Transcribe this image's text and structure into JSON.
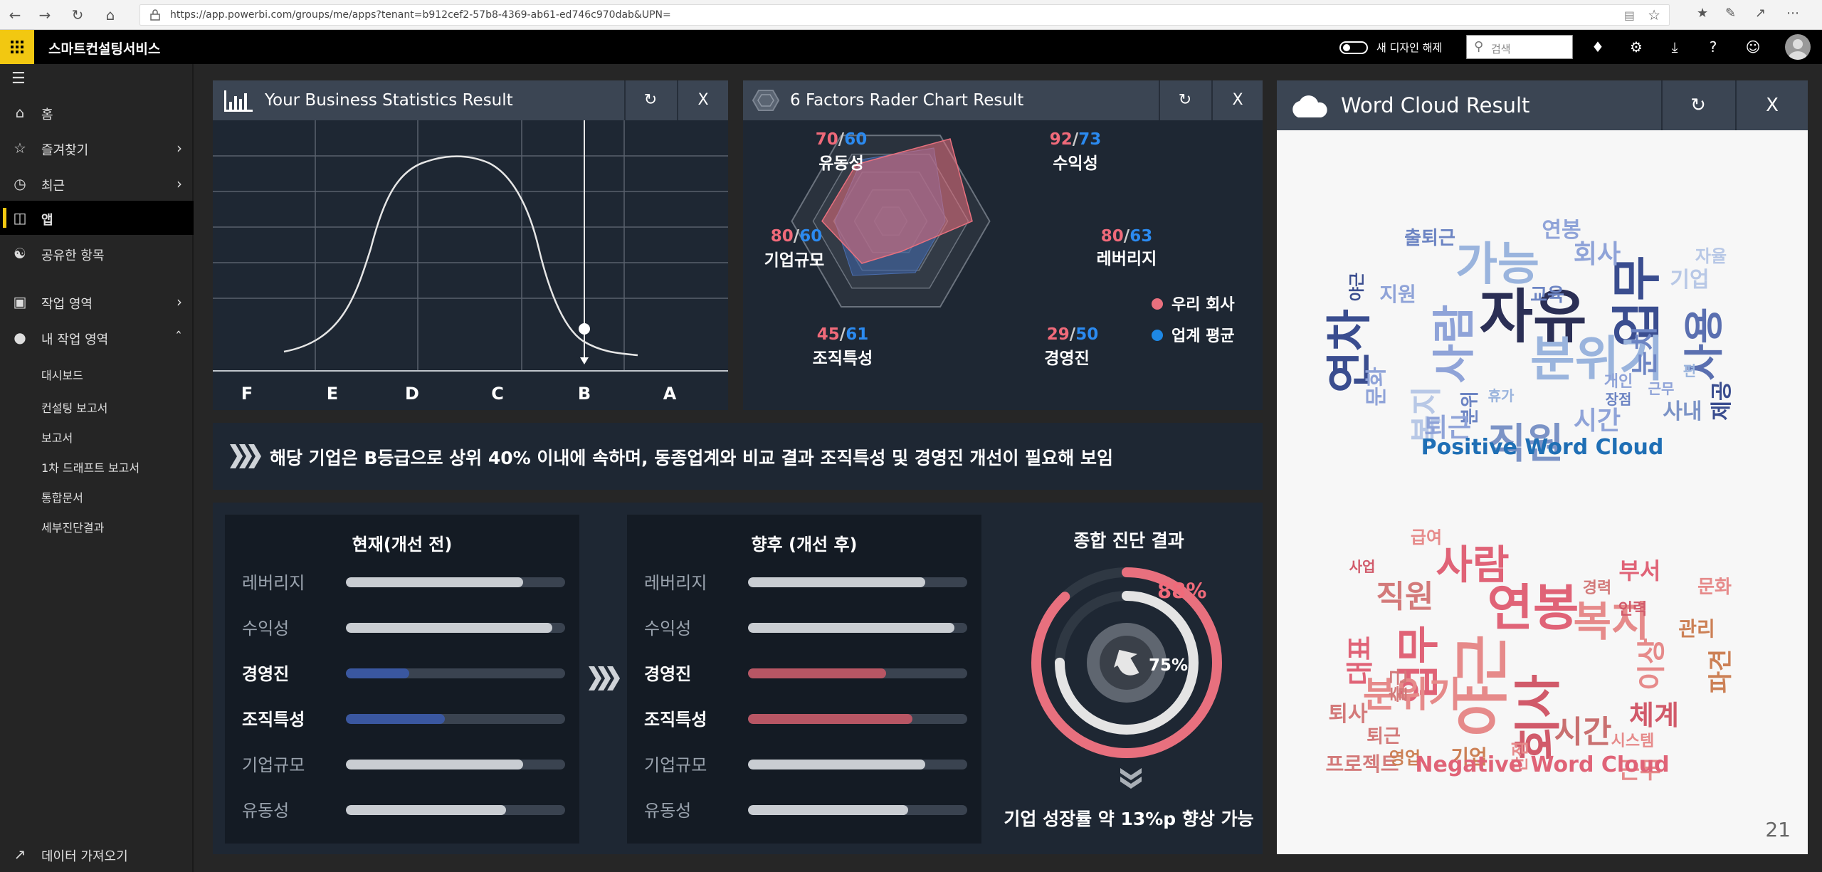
{
  "browser": {
    "url": "https://app.powerbi.com/groups/me/apps?tenant=b912cef2-57b8-4369-ab61-ed746c970dab&UPN="
  },
  "header": {
    "app_title": "스마트컨설팅서비스",
    "new_design_label": "새 디자인 해제",
    "search_placeholder": "검색"
  },
  "leftnav": {
    "items": [
      {
        "label": "홈",
        "icon": "home-icon"
      },
      {
        "label": "즐겨찾기",
        "icon": "star-icon"
      },
      {
        "label": "최근",
        "icon": "clock-icon"
      },
      {
        "label": "앱",
        "icon": "apps-icon"
      },
      {
        "label": "공유한 항목",
        "icon": "shared-icon"
      },
      {
        "label": "작업 영역",
        "icon": "workspace-icon"
      },
      {
        "label": "내 작업 영역",
        "icon": "user-icon"
      }
    ],
    "sub_items": [
      "대시보드",
      "컨설팅 보고서",
      "보고서",
      "1차 드래프트 보고서",
      "통합문서",
      "세부진단결과"
    ],
    "footer": "데이터 가져오기"
  },
  "stats_panel": {
    "title": "Your Business Statistics Result",
    "grades": [
      "F",
      "E",
      "D",
      "C",
      "B",
      "A"
    ],
    "current_grade": "B",
    "close_label": "X"
  },
  "radar_panel": {
    "title": "6 Factors Rader Chart Result",
    "close_label": "X",
    "legend": [
      {
        "label": "우리 회사",
        "color": "#e8707e"
      },
      {
        "label": "업계 평균",
        "color": "#1e88e5"
      }
    ],
    "factors": [
      {
        "name": "유동성",
        "ours": "70",
        "avg": "60"
      },
      {
        "name": "수익성",
        "ours": "92",
        "avg": "73"
      },
      {
        "name": "레버리지",
        "ours": "80",
        "avg": "63"
      },
      {
        "name": "경영진",
        "ours": "29",
        "avg": "50"
      },
      {
        "name": "조직특성",
        "ours": "45",
        "avg": "61"
      },
      {
        "name": "기업규모",
        "ours": "80",
        "avg": "60"
      }
    ],
    "sep": "/"
  },
  "banner": {
    "text": "해당 기업은 B등급으로 상위 40% 이내에 속하며, 동종업계와 비교 결과 조직특성 및 경영진 개선이 필요해 보임"
  },
  "before": {
    "title": "현재(개선 전)",
    "rows": [
      {
        "label": "레버리지",
        "value": 0.81,
        "highlight": false
      },
      {
        "label": "수익성",
        "value": 0.94,
        "highlight": false
      },
      {
        "label": "경영진",
        "value": 0.29,
        "highlight": true
      },
      {
        "label": "조직특성",
        "value": 0.45,
        "highlight": true
      },
      {
        "label": "기업규모",
        "value": 0.81,
        "highlight": false
      },
      {
        "label": "유동성",
        "value": 0.73,
        "highlight": false
      }
    ],
    "bar_color": "#c9cdd2",
    "highlight_color": "#3a57a0"
  },
  "after": {
    "title": "향후 (개선 후)",
    "rows": [
      {
        "label": "레버리지",
        "value": 0.81,
        "highlight": false
      },
      {
        "label": "수익성",
        "value": 0.94,
        "highlight": false
      },
      {
        "label": "경영진",
        "value": 0.63,
        "highlight": true
      },
      {
        "label": "조직특성",
        "value": 0.75,
        "highlight": true
      },
      {
        "label": "기업규모",
        "value": 0.81,
        "highlight": false
      },
      {
        "label": "유동성",
        "value": 0.73,
        "highlight": false
      }
    ],
    "bar_color": "#c9cdd2",
    "highlight_color": "#b85664"
  },
  "summary": {
    "title": "종합 진단 결과",
    "outer_pct": "88%",
    "inner_pct": "75%",
    "outer_value": 0.88,
    "inner_value": 0.75,
    "caption": "기업 성장률 약 13%p 향상 가능"
  },
  "wordcloud": {
    "title": "Word Cloud Result",
    "close_label": "X",
    "positive_caption": "Positive Word Cloud",
    "negative_caption": "Negative Word Cloud",
    "page_number": "21",
    "positive_words": [
      "자유",
      "업무",
      "분위기",
      "연차",
      "사람",
      "가능",
      "직원",
      "사용",
      "눈치",
      "시간",
      "회사",
      "기업",
      "연봉",
      "제공",
      "사내",
      "지원",
      "복지",
      "근무",
      "분위",
      "문화",
      "퇴근",
      "출퇴근",
      "편",
      "장점",
      "야근",
      "개인",
      "자율",
      "교육",
      "휴가"
    ],
    "negative_words": [
      "연봉",
      "야근",
      "회사",
      "사람",
      "업무",
      "복지",
      "직원",
      "분위기",
      "시간",
      "체계",
      "근무",
      "기업",
      "이상",
      "대표",
      "퇴사",
      "부서",
      "관리",
      "시스템",
      "출근",
      "프로젝트",
      "급여",
      "문화",
      "파견",
      "인력",
      "단점",
      "퇴근",
      "영업",
      "사업",
      "경력"
    ]
  }
}
